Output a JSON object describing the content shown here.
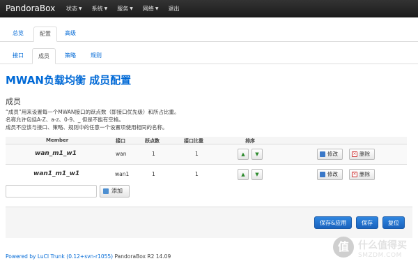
{
  "navbar": {
    "brand": "PandoraBox",
    "menus": [
      {
        "label": "状态",
        "has_caret": true
      },
      {
        "label": "系统",
        "has_caret": true
      },
      {
        "label": "服务",
        "has_caret": true
      },
      {
        "label": "网络",
        "has_caret": true
      },
      {
        "label": "退出",
        "has_caret": false
      }
    ]
  },
  "tabs_level1": [
    {
      "label": "总览",
      "active": false
    },
    {
      "label": "配置",
      "active": true
    },
    {
      "label": "高级",
      "active": false
    }
  ],
  "tabs_level2": [
    {
      "label": "接口",
      "active": false
    },
    {
      "label": "成员",
      "active": true
    },
    {
      "label": "策略",
      "active": false
    },
    {
      "label": "规则",
      "active": false
    }
  ],
  "page_title": "MWAN负载均衡 成员配置",
  "section": {
    "title": "成员",
    "description": [
      "“成员”用来设置每一个MWAN接口的跃点数（即接口优先级）和所占比重。",
      "名称允许包括A-Z、a-z、0-9、_ 但是不能有空格。",
      "成员不应该与接口、策略、规则中的任意一个设置项使用相同的名称。"
    ]
  },
  "table": {
    "headers": {
      "member": "Member",
      "interface": "接口",
      "metric": "跃点数",
      "weight": "接口比重",
      "sort": "排序"
    },
    "rows": [
      {
        "member": "wan_m1_w1",
        "interface": "wan",
        "metric": "1",
        "weight": "1"
      },
      {
        "member": "wan1_m1_w1",
        "interface": "wan1",
        "metric": "1",
        "weight": "1"
      }
    ],
    "edit_label": "修改",
    "delete_label": "删除"
  },
  "add": {
    "input_value": "",
    "button_label": "添加"
  },
  "actions": {
    "save_apply": "保存&应用",
    "save": "保存",
    "reset": "复位"
  },
  "footer": {
    "link_text": "Powered by LuCI Trunk (0.12+svn-r1055)",
    "version_text": "PandoraBox R2 14.09"
  },
  "watermark": {
    "glyph": "值",
    "line1": "什么值得买",
    "line2": "SMZDM.COM"
  },
  "colors": {
    "accent": "#0069d6",
    "primary_button": "#1a6fd0",
    "navbar": "#222222"
  }
}
